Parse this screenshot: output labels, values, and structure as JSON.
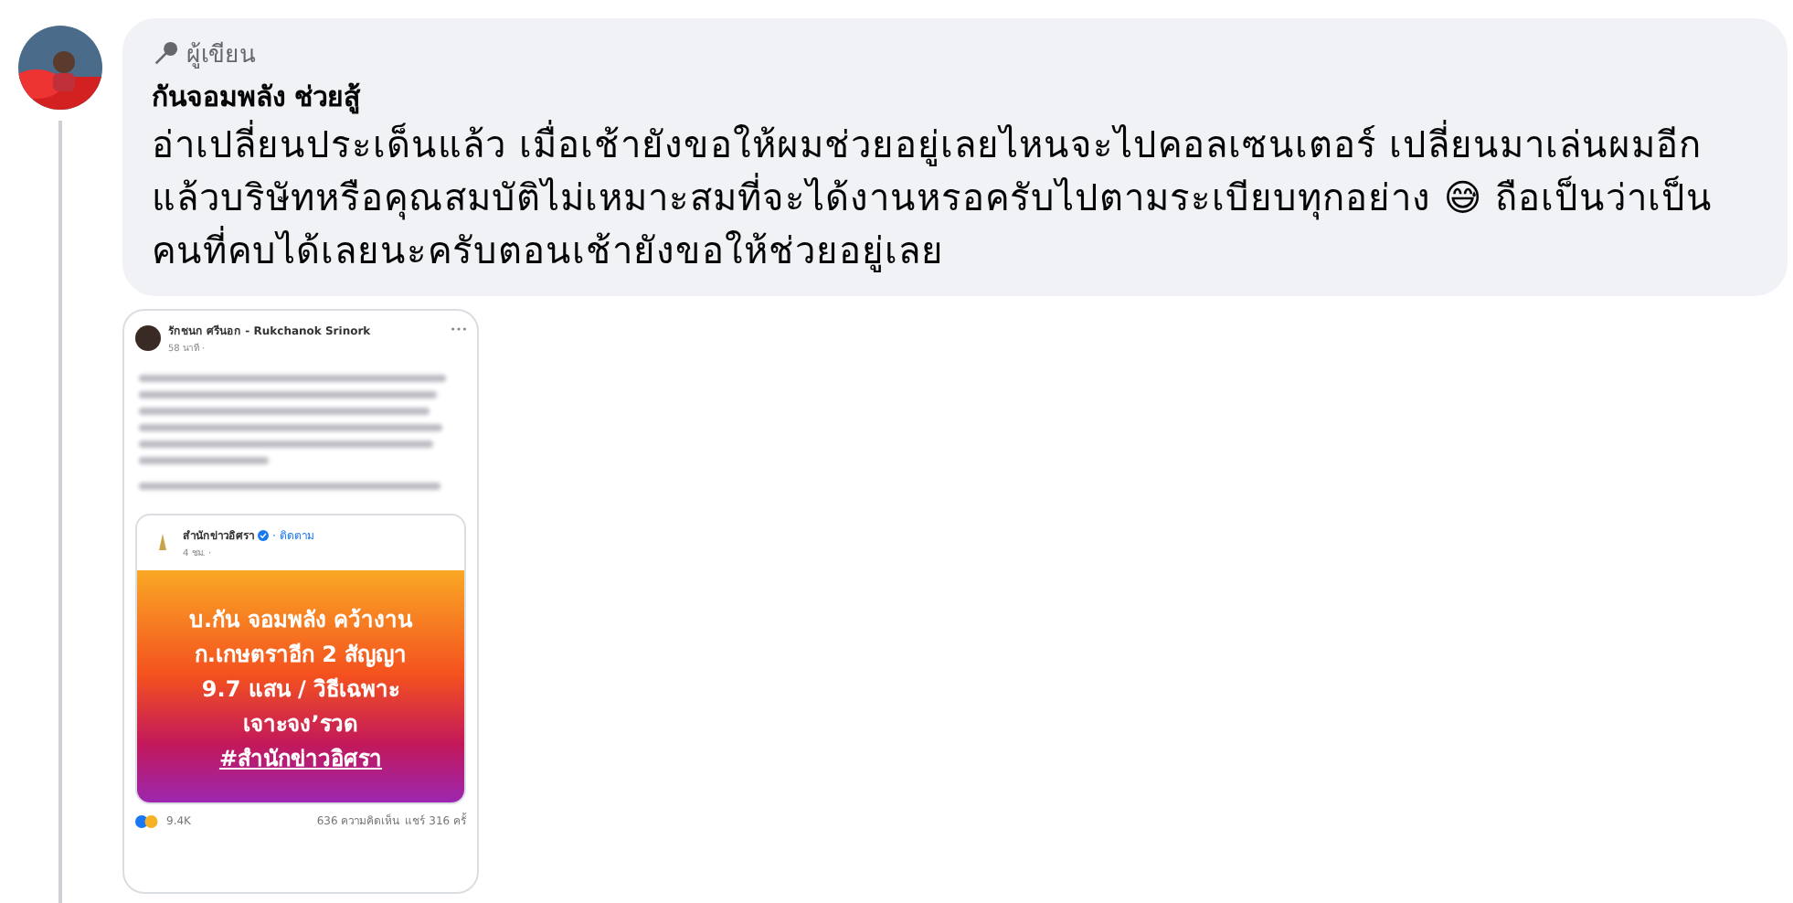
{
  "comment": {
    "badge": "ผู้เขียน",
    "author": "กันจอมพลัง ช่วยสู้",
    "text": "อ่าเปลี่ยนประเด็นแล้ว เมื่อเช้ายังขอให้ผมช่วยอยู่เลยไหนจะไปคอลเซนเตอร์ เปลี่ยนมาเล่นผมอีก แล้วบริษัทหรือคุณสมบัติไม่เหมาะสมที่จะได้งานหรอครับไปตามระเบียบทุกอย่าง 😅 ถือเป็นว่าเป็นคนที่คบได้เลยนะครับตอนเช้ายังขอให้ช่วยอยู่เลย"
  },
  "attachment": {
    "author": "รักชนก ศรีนอก - Rukchanok Srinork",
    "time": "58 นาที ·",
    "shared_page": "สำนักข่าวอิศรา",
    "follow": "· ติดตาม",
    "shared_time": "4 ชม. ·",
    "headline": [
      "บ.กัน จอมพลัง คว้างาน",
      "ก.เกษตราอีก 2 สัญญา",
      "9.7 แสน / วิธีเฉพาะ",
      "เจาะจง’รวด"
    ],
    "hashtag": "#สำนักข่าวอิศรา",
    "reactions": "9.4K",
    "comments": "636 ความคิดเห็น",
    "shares": "แชร์ 316 ครั้"
  }
}
